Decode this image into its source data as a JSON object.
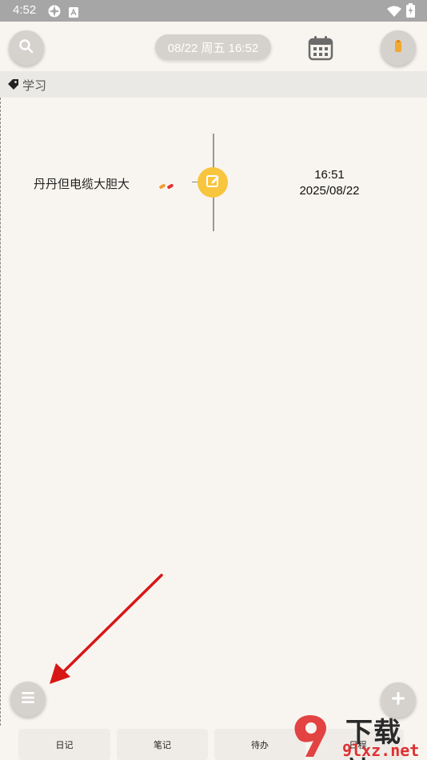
{
  "status_bar": {
    "time": "4:52"
  },
  "header": {
    "date_display": "08/22 周五  16:52",
    "icons": [
      "search-icon",
      "calendar-icon",
      "bookmark-icon"
    ]
  },
  "tag_bar": {
    "label": "学习"
  },
  "entries": [
    {
      "title": "丹丹但电缆大胆大",
      "time": "16:51",
      "date": "2025/08/22"
    }
  ],
  "bottom_tabs": [
    {
      "label": "日记"
    },
    {
      "label": "笔记"
    },
    {
      "label": "待办"
    },
    {
      "label": "日程"
    }
  ],
  "watermark": {
    "main": "下载站",
    "sub": "9lxz.net"
  },
  "colors": {
    "accent": "#f7c53e",
    "background": "#f8f5f0",
    "arrow": "#d81616",
    "bookmark": "#f0a830"
  }
}
